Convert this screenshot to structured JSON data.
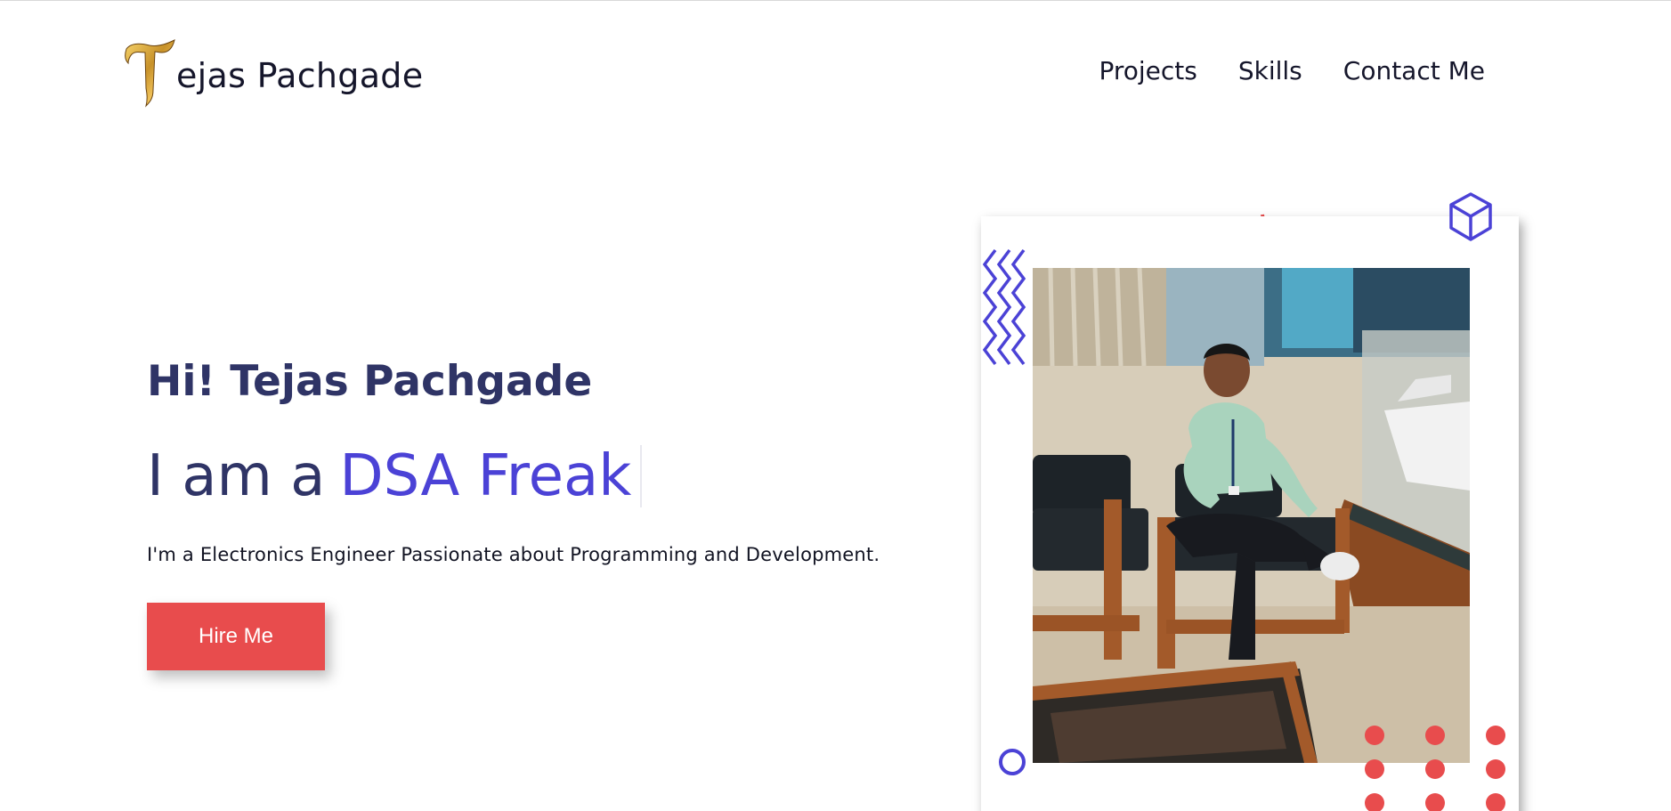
{
  "brand": {
    "logo_icon": "gold-letter-t-icon",
    "name": "ejas Pachgade"
  },
  "nav": {
    "items": [
      {
        "label": "Projects"
      },
      {
        "label": "Skills"
      },
      {
        "label": "Contact Me"
      }
    ]
  },
  "hero": {
    "greeting": "Hi! Tejas Pachgade",
    "role_prefix": "I am a",
    "role": "DSA Freak",
    "tagline": "I'm a Electronics Engineer Passionate about Programming and Development.",
    "hire_label": "Hire Me"
  },
  "colors": {
    "accent": "#4b42d6",
    "button": "#e84c4d",
    "heading": "#2f3466",
    "decor_red": "#e84c4d",
    "decor_blue": "#4b42d6"
  },
  "photo": {
    "alt": "profile-photo"
  }
}
